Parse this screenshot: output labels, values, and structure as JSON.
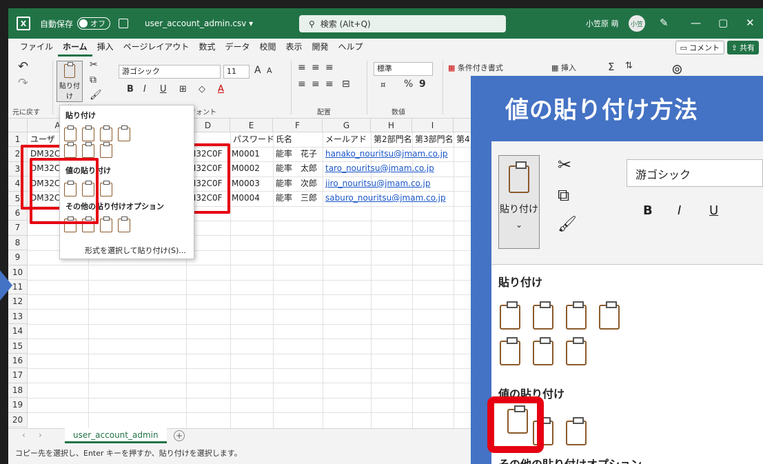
{
  "titlebar": {
    "app_icon": "excel-icon",
    "autosave_label": "自動保存",
    "autosave_state": "オフ",
    "filename": "user_account_admin.csv ▾",
    "search_placeholder": "検索 (Alt+Q)",
    "user_name": "小笠原 萌",
    "avatar_text": "小笠",
    "win_min": "—",
    "win_restore": "▢",
    "win_close": "✕"
  },
  "menu": {
    "tabs": [
      "ファイル",
      "ホーム",
      "挿入",
      "ページレイアウト",
      "数式",
      "データ",
      "校閲",
      "表示",
      "開発",
      "ヘルプ"
    ],
    "active": "ホーム",
    "comment_label": "コメント",
    "share_label": "共有"
  },
  "ribbon": {
    "undo_group": "元に戻す",
    "paste_label": "貼り付け",
    "font_name": "游ゴシック",
    "font_size": "11",
    "font_group": "フォント",
    "align_group": "配置",
    "number_format": "標準",
    "number_group": "数値",
    "conditional_format": "条件付き書式",
    "insert_label": "挿入",
    "font_inc": "A",
    "font_dec": "A",
    "bold": "B",
    "italic": "I",
    "underline": "U",
    "percent": "%",
    "comma": "9"
  },
  "grid": {
    "columns": [
      "A",
      "D",
      "E",
      "F",
      "G",
      "H",
      "I"
    ],
    "rows": [
      "1",
      "2",
      "3",
      "4",
      "5",
      "6",
      "7",
      "8",
      "9",
      "10",
      "11",
      "12",
      "13",
      "14",
      "15",
      "16",
      "17",
      "18",
      "19",
      "20"
    ],
    "cells": {
      "a1": "ユーザ",
      "a2": "DM32C",
      "a3": "DM32C",
      "a4": "DM32C",
      "a5": "DM32C",
      "e1": "パスワード",
      "f1": "氏名",
      "g1": "メールアド",
      "h1": "第2部門名",
      "i1": "第3部門名",
      "j1": "第4",
      "d2": "M32C0F",
      "d3": "M32C0F",
      "d4": "M32C0F",
      "d5": "M32C0F",
      "e2": "M0001",
      "e3": "M0002",
      "e4": "M0003",
      "e5": "M0004",
      "f2": "能率　花子",
      "f3": "能率　太郎",
      "f4": "能率　次郎",
      "f5": "能率　三郎",
      "g2": "hanako_nouritsu@jmam.co.jp",
      "g3": "taro_nouritsu@jmam.co.jp",
      "g4": "jiro_nouritsu@jmam.co.jp",
      "g5": "saburo_nouritsu@jmam.co.jp"
    }
  },
  "dropdown": {
    "paste_title": "貼り付け",
    "values_title": "値の貼り付け",
    "other_title": "その他の貼り付けオプション",
    "special_link": "形式を選択して貼り付け(S)..."
  },
  "sheet": {
    "tab_name": "user_account_admin",
    "add": "+"
  },
  "status": {
    "message": "コピー先を選択し、Enter キーを押すか、貼り付けを選択します。"
  },
  "callout": {
    "title": "値の貼り付け方法",
    "paste_label": "貼り付け",
    "font_name": "游ゴシック",
    "paste_section": "貼り付け",
    "values_section": "値の貼り付け",
    "other_section": "その他の貼り付けオプション",
    "bold": "B",
    "italic": "I",
    "underline": "U"
  },
  "colors": {
    "excel_green": "#217346",
    "highlight_red": "#e60012",
    "callout_blue": "#4472c4",
    "link_blue": "#1a56c9"
  }
}
